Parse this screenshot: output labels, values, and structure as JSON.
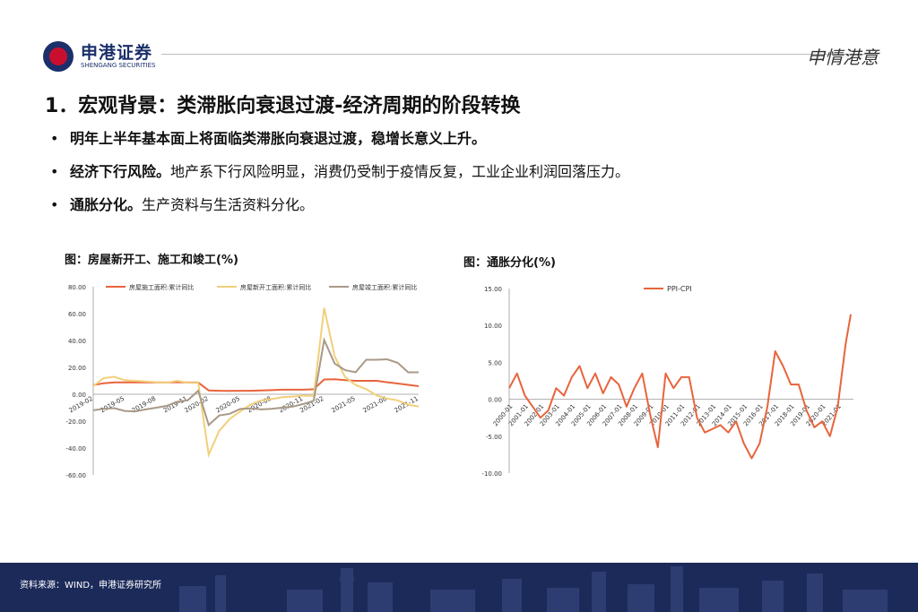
{
  "header": {
    "logo_cn": "申港证券",
    "logo_en": "SHENGANG SECURITIES",
    "slogan": "申情港意"
  },
  "title": "1．宏观背景：类滞胀向衰退过渡-经济周期的阶段转换",
  "bullets": [
    {
      "bold": "明年上半年基本面上将面临类滞胀向衰退过渡，稳增长意义上升。",
      "rest": ""
    },
    {
      "bold": "经济下行风险。",
      "rest": "地产系下行风险明显，消费仍受制于疫情反复，工业企业利润回落压力。"
    },
    {
      "bold": "通胀分化。",
      "rest": "生产资料与生活资料分化。"
    }
  ],
  "chart1": {
    "caption": "图：房屋新开工、施工和竣工(%)"
  },
  "chart2": {
    "caption": "图：通胀分化(%)"
  },
  "footer": {
    "source": "资料来源：WIND，申港证券研究所"
  },
  "colors": {
    "red": "#e8643c",
    "yellow": "#f2cf7a",
    "gray": "#a89a88",
    "navy": "#1c2a5a"
  },
  "chart_data": [
    {
      "type": "line",
      "title": "图：房屋新开工、施工和竣工(%)",
      "ylim": [
        -60,
        80
      ],
      "yticks": [
        "80.00",
        "60.00",
        "40.00",
        "20.00",
        "0.00",
        "-20.00",
        "-40.00",
        "-60.00"
      ],
      "categories": [
        "2019-02",
        "2019-03",
        "2019-04",
        "2019-05",
        "2019-06",
        "2019-07",
        "2019-08",
        "2019-09",
        "2019-10",
        "2019-11",
        "2019-12",
        "2020-02",
        "2020-03",
        "2020-04",
        "2020-05",
        "2020-06",
        "2020-07",
        "2020-08",
        "2020-09",
        "2020-10",
        "2020-11",
        "2020-12",
        "2021-02",
        "2021-03",
        "2021-04",
        "2021-05",
        "2021-06",
        "2021-07",
        "2021-08",
        "2021-09",
        "2021-10",
        "2021-11"
      ],
      "xtick_labels": [
        "2019-02",
        "2019-05",
        "2019-08",
        "2019-11",
        "2020-02",
        "2020-05",
        "2020-08",
        "2020-11",
        "2021-02",
        "2021-05",
        "2021-08",
        "2021-11"
      ],
      "series": [
        {
          "name": "房屋施工面积:累计同比",
          "color": "#e8643c",
          "values": [
            6.8,
            8.2,
            8.8,
            8.8,
            8.8,
            8.8,
            8.8,
            8.7,
            9.0,
            8.7,
            8.7,
            2.9,
            2.6,
            2.5,
            2.6,
            2.6,
            2.9,
            3.1,
            3.4,
            3.4,
            3.4,
            3.7,
            11.0,
            11.2,
            10.5,
            10.0,
            10.0,
            10.0,
            8.9,
            8.0,
            7.0,
            6.0
          ]
        },
        {
          "name": "房屋新开工面积:累计同比",
          "color": "#f2cf7a",
          "values": [
            6.0,
            12.0,
            13.0,
            10.5,
            10.0,
            9.5,
            9.0,
            8.6,
            10.0,
            8.6,
            8.5,
            -44.9,
            -27.2,
            -18.4,
            -12.8,
            -7.6,
            -4.5,
            -3.6,
            -2.2,
            -1.7,
            -1.0,
            -1.2,
            64.3,
            28.2,
            12.8,
            6.9,
            3.8,
            -0.9,
            -3.2,
            -4.5,
            -7.7,
            -9.1
          ]
        },
        {
          "name": "房屋竣工面积:累计同比",
          "color": "#a89a88",
          "values": [
            -11.9,
            -10.8,
            -10.3,
            -12.4,
            -12.7,
            -11.3,
            -10.0,
            -8.6,
            -5.5,
            -4.5,
            2.6,
            -22.9,
            -15.8,
            -14.5,
            -10.9,
            -10.5,
            -11.3,
            -10.8,
            -9.9,
            -9.2,
            -7.3,
            -4.9,
            40.4,
            22.9,
            17.9,
            16.4,
            25.7,
            25.7,
            26.0,
            23.4,
            16.3,
            16.3
          ]
        }
      ]
    },
    {
      "type": "line",
      "title": "图：通胀分化(%)",
      "ylim": [
        -10,
        15
      ],
      "yticks": [
        "15.00",
        "10.00",
        "5.00",
        "0.00",
        "-5.00",
        "-10.00"
      ],
      "xtick_labels": [
        "2000-01",
        "2001-01",
        "2002-01",
        "2003-01",
        "2004-01",
        "2005-01",
        "2006-01",
        "2007-01",
        "2008-01",
        "2009-01",
        "2010-01",
        "2011-01",
        "2012-01",
        "2013-01",
        "2014-01",
        "2015-01",
        "2016-01",
        "2017-01",
        "2018-01",
        "2019-01",
        "2020-01",
        "2021-01"
      ],
      "x": [
        2000.0,
        2000.5,
        2001.0,
        2001.5,
        2002.0,
        2002.5,
        2003.0,
        2003.5,
        2004.0,
        2004.5,
        2005.0,
        2005.5,
        2006.0,
        2006.5,
        2007.0,
        2007.5,
        2008.0,
        2008.5,
        2009.0,
        2009.5,
        2010.0,
        2010.5,
        2011.0,
        2011.5,
        2012.0,
        2012.5,
        2013.0,
        2013.5,
        2014.0,
        2014.5,
        2015.0,
        2015.5,
        2016.0,
        2016.5,
        2017.0,
        2017.5,
        2018.0,
        2018.5,
        2019.0,
        2019.5,
        2020.0,
        2020.5,
        2021.0,
        2021.5,
        2021.83
      ],
      "series": [
        {
          "name": "PPI-CPI",
          "color": "#e8643c",
          "values": [
            1.5,
            3.5,
            0.5,
            -1.0,
            -2.5,
            -1.5,
            1.5,
            0.5,
            3.0,
            4.5,
            1.5,
            3.5,
            0.8,
            3.0,
            2.0,
            -1.0,
            1.5,
            3.5,
            -2.0,
            -6.5,
            3.5,
            1.5,
            3.0,
            3.0,
            -2.5,
            -4.5,
            -4.0,
            -3.5,
            -4.5,
            -3.0,
            -6.0,
            -8.0,
            -6.0,
            -1.0,
            6.5,
            4.5,
            2.0,
            2.0,
            -1.5,
            -3.8,
            -3.0,
            -5.0,
            -1.0,
            7.5,
            11.5
          ]
        }
      ]
    }
  ]
}
